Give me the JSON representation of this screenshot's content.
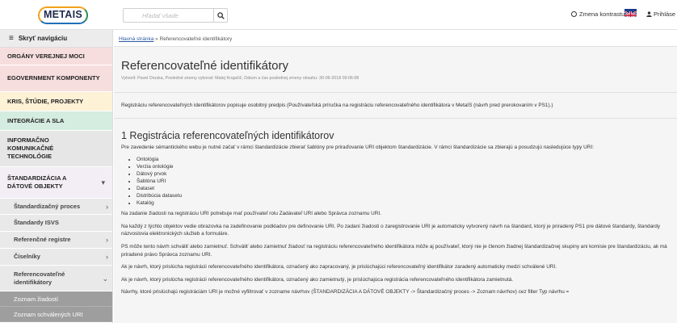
{
  "header": {
    "logo_text": "METAIS",
    "search_placeholder": "Hľadať všade",
    "contrast_label": "Zmena kontrastu",
    "login_label": "Prihláse"
  },
  "sidebar": {
    "hide_label": "Skryť navigáciu",
    "categories": [
      {
        "label": "ORGÁNY VEREJNEJ MOCI",
        "color": "#f7dede"
      },
      {
        "label": "EGOVERNMENT KOMPONENTY",
        "color": "#f7dede"
      },
      {
        "label": "KRIS, ŠTÚDIE, PROJEKTY",
        "color": "#fdf1d6"
      },
      {
        "label": "INTEGRÁCIE A SLA",
        "color": "#d5ece0"
      },
      {
        "label": "INFORMAČNO KOMUNIKAČNÉ TECHNOLÓGIE",
        "color": "#e6e6e6"
      },
      {
        "label": "ŠTANDARDIZÁCIA A DÁTOVÉ OBJEKTY",
        "color": "#f3eef5"
      }
    ],
    "sub_items": [
      {
        "label": "Štandardizačný proces"
      },
      {
        "label": "Štandardy ISVS"
      },
      {
        "label": "Referenčné registre"
      },
      {
        "label": "Číselníky"
      },
      {
        "label": "Referencovateľné identifikátory"
      }
    ],
    "sub_sub_items": [
      {
        "label": "Zoznam žiadostí"
      },
      {
        "label": "Zoznam schválených URI"
      }
    ]
  },
  "breadcrumb": {
    "home": "Hlavná stránka",
    "separator": "»",
    "current": "Referencovateľné identifikátory"
  },
  "page": {
    "title": "Referencovateľné identifikátory",
    "meta": "Vytvoril: Pavel Druska, Posledné zmeny vykonal: Matej Krajačič, Dátum a čas poslednej zmeny obsahu: 30-06-2018 09:06:08",
    "intro": "Registráciu referencovateľných identifikátorov popisuje osobitný predpis (Používateľská príručka na registráciu referencovateľného identifikátora v MetaIS (návrh pred prerokovaním v PS1).)",
    "section_title": "1 Registrácia referencovateľných identifikátorov",
    "section_p1": "Pre zavedenie sémantického webu je nutné začať v rámci štandardizácie zbierať šablóny pre priraďovanie URI objektom štandardizácie. V rámci štandardizácie sa zbierajú a posudzujú nasledujúce typy URI:",
    "types": [
      "Ontológia",
      "Verzia ontológie",
      "Dátový prvok",
      "Šablóna URI",
      "Dataset",
      "Distribúcia datasetu",
      "Katalóg"
    ],
    "p2": "Na zadanie žiadosti na registráciu URI potrebuje mať používateľ rolu Zadávateľ URI alebo Správca zoznamu URI.",
    "p3": "Na každý z týchto objektov vedie obrazovka na zadefinovanie podkladov pre definovanie URI. Po zadaní žiadosti o zaregistrovanie URI je automaticky vytvorený návrh na štandard, ktorý je priradený PS1 pre dátové štandardy, štandardy názvoslovia elektronických služieb a formuláre.",
    "p4": "PS môže tento návrh schváliť alebo zamietnuť. Schváliť alebo zamietnuť žiadosť na registráciu referencovateľného identifikátora môže aj používateľ, ktorý nie je členom žiadnej štandardizačnej skupiny ani komisie pre štandardizáciu, ak má priradené právo Správca zoznamu URI.",
    "p5": "Ak je návrh, ktorý prislúcha registrácii referencovateľného identifikátora, označený ako zapracovaný, je prislúchajúci referencovateľný identifikátor zaradený automaticky medzi schválené URI.",
    "p6": "Ak je návrh, ktorý prislúcha registrácii referencovateľného identifikátora, označený ako zamietnutý, je prislúchajúca registrácia referencovateľného identifikátora zamietnutá.",
    "p7": "Návrhy, ktoré prislúchajú registráciám URI je možné vyfiltrovať v zozname návrhov (ŠTANDARDIZÁCIA A DÁTOVÉ OBJEKTY -> Štandardizačný proces -> Zoznam návrhov) cez filter Typ návrhu ="
  }
}
